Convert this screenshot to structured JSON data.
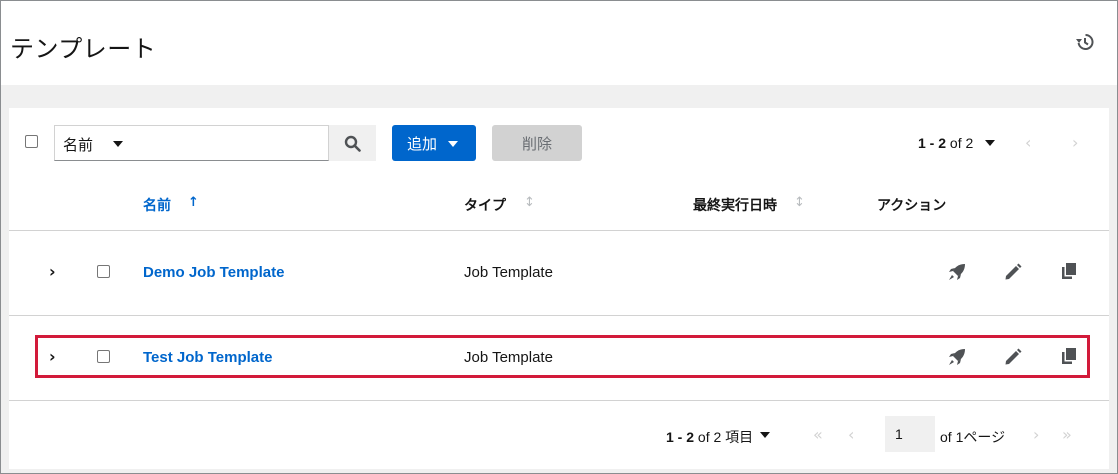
{
  "header": {
    "title": "テンプレート",
    "history_icon": "history-icon"
  },
  "toolbar": {
    "filter_label": "名前",
    "search_placeholder": "",
    "add_label": "追加",
    "delete_label": "削除",
    "pagination": {
      "range": "1 - 2",
      "of_text": "of 2"
    }
  },
  "table": {
    "headers": {
      "name": "名前",
      "type": "タイプ",
      "last_run": "最終実行日時",
      "actions": "アクション"
    },
    "rows": [
      {
        "name": "Demo Job Template",
        "type": "Job Template"
      },
      {
        "name": "Test Job Template",
        "type": "Job Template"
      }
    ]
  },
  "footer": {
    "range": "1 - 2",
    "of_items": "of 2 項目",
    "page_value": "1",
    "of_pages": "of 1ページ"
  },
  "colors": {
    "accent": "#0066cc",
    "highlight": "#d21a3a"
  }
}
